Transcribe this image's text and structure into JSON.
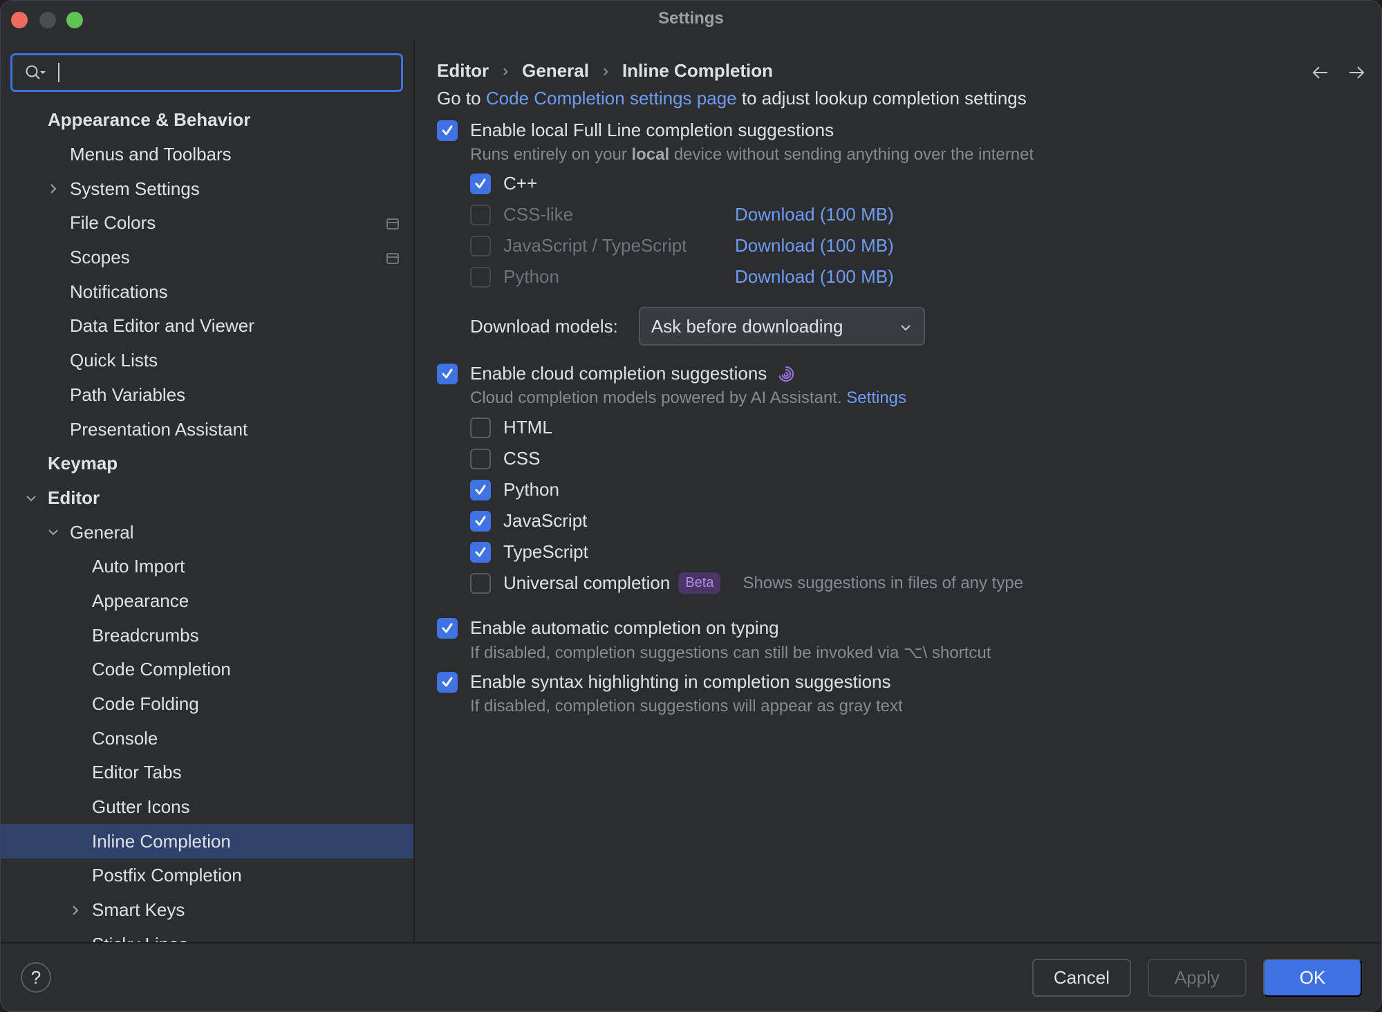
{
  "window": {
    "title": "Settings"
  },
  "search": {
    "value": "",
    "placeholder": ""
  },
  "sidebar": {
    "items": [
      {
        "label": "Appearance & Behavior",
        "level": 0,
        "bold": true,
        "chevron": "none"
      },
      {
        "label": "Menus and Toolbars",
        "level": 1,
        "chevron": "none"
      },
      {
        "label": "System Settings",
        "level": 1,
        "chevron": "right"
      },
      {
        "label": "File Colors",
        "level": 1,
        "chevron": "none",
        "scope_icon": true
      },
      {
        "label": "Scopes",
        "level": 1,
        "chevron": "none",
        "scope_icon": true
      },
      {
        "label": "Notifications",
        "level": 1,
        "chevron": "none"
      },
      {
        "label": "Data Editor and Viewer",
        "level": 1,
        "chevron": "none"
      },
      {
        "label": "Quick Lists",
        "level": 1,
        "chevron": "none"
      },
      {
        "label": "Path Variables",
        "level": 1,
        "chevron": "none"
      },
      {
        "label": "Presentation Assistant",
        "level": 1,
        "chevron": "none"
      },
      {
        "label": "Keymap",
        "level": 0,
        "bold": true,
        "chevron": "none"
      },
      {
        "label": "Editor",
        "level": 0,
        "bold": true,
        "chevron": "down"
      },
      {
        "label": "General",
        "level": 1,
        "chevron": "down"
      },
      {
        "label": "Auto Import",
        "level": 2,
        "chevron": "none"
      },
      {
        "label": "Appearance",
        "level": 2,
        "chevron": "none"
      },
      {
        "label": "Breadcrumbs",
        "level": 2,
        "chevron": "none"
      },
      {
        "label": "Code Completion",
        "level": 2,
        "chevron": "none"
      },
      {
        "label": "Code Folding",
        "level": 2,
        "chevron": "none"
      },
      {
        "label": "Console",
        "level": 2,
        "chevron": "none"
      },
      {
        "label": "Editor Tabs",
        "level": 2,
        "chevron": "none"
      },
      {
        "label": "Gutter Icons",
        "level": 2,
        "chevron": "none"
      },
      {
        "label": "Inline Completion",
        "level": 2,
        "chevron": "none",
        "selected": true
      },
      {
        "label": "Postfix Completion",
        "level": 2,
        "chevron": "none"
      },
      {
        "label": "Smart Keys",
        "level": 2,
        "chevron": "right"
      },
      {
        "label": "Sticky Lines",
        "level": 2,
        "chevron": "none"
      }
    ]
  },
  "breadcrumb": [
    "Editor",
    "General",
    "Inline Completion"
  ],
  "breadcrumb_separator": "›",
  "intro": {
    "prefix": "Go to",
    "link": "Code Completion settings page",
    "suffix": "to adjust lookup completion settings"
  },
  "local": {
    "label": "Enable local Full Line completion suggestions",
    "checked": true,
    "desc_prefix": "Runs entirely on your",
    "desc_bold": "local",
    "desc_suffix": "device without sending anything over the internet",
    "languages": [
      {
        "label": "C++",
        "checked": true,
        "enabled": true,
        "download": ""
      },
      {
        "label": "CSS-like",
        "checked": false,
        "enabled": false,
        "download": "Download (100 MB)"
      },
      {
        "label": "JavaScript / TypeScript",
        "checked": false,
        "enabled": false,
        "download": "Download (100 MB)"
      },
      {
        "label": "Python",
        "checked": false,
        "enabled": false,
        "download": "Download (100 MB)"
      }
    ],
    "download_models_label": "Download models:",
    "download_models_value": "Ask before downloading"
  },
  "cloud": {
    "label": "Enable cloud completion suggestions",
    "checked": true,
    "icon": "ai-assistant-spiral-icon",
    "desc": "Cloud completion models powered by AI Assistant.",
    "settings_link": "Settings",
    "languages": [
      {
        "label": "HTML",
        "checked": false
      },
      {
        "label": "CSS",
        "checked": false
      },
      {
        "label": "Python",
        "checked": true
      },
      {
        "label": "JavaScript",
        "checked": true
      },
      {
        "label": "TypeScript",
        "checked": true
      }
    ],
    "universal": {
      "label": "Universal completion",
      "checked": false,
      "badge": "Beta",
      "desc": "Shows suggestions in files of any type"
    }
  },
  "auto": {
    "label": "Enable automatic completion on typing",
    "checked": true,
    "desc": "If disabled, completion suggestions can still be invoked via ⌥\\ shortcut"
  },
  "syntax": {
    "label": "Enable syntax highlighting in completion suggestions",
    "checked": true,
    "desc": "If disabled, completion suggestions will appear as gray text"
  },
  "footer": {
    "help": "?",
    "cancel": "Cancel",
    "apply": "Apply",
    "ok": "OK"
  },
  "colors": {
    "accent": "#3f73e3",
    "link": "#6f9cf3",
    "selection": "#2e426b",
    "beta_bg": "#4a3566",
    "beta_fg": "#b48be6",
    "ai_icon": "#9b6fdc"
  }
}
